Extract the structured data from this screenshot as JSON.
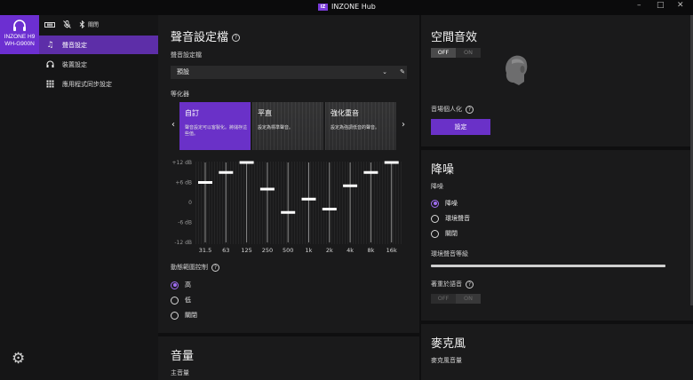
{
  "window": {
    "title": "INZONE Hub",
    "logo_text": "IZ",
    "controls": {
      "minimize": "–",
      "maximize": "□",
      "close": "✕"
    }
  },
  "sidebar": {
    "device": {
      "name": "INZONE H9",
      "model": "WH-G900N"
    },
    "status": {
      "battery": "▮▮▮",
      "anc_label": "關閉"
    },
    "items": [
      {
        "label": "聲音設定",
        "icon": "♫",
        "active": true
      },
      {
        "label": "裝置設定",
        "icon": "headphones",
        "active": false
      },
      {
        "label": "應用程式同步設定",
        "icon": "grid",
        "active": false
      }
    ],
    "settings_icon": "⚙"
  },
  "sound": {
    "title": "聲音設定檔",
    "profile_label": "聲音設定檔",
    "profile_value": "預設",
    "eq_label": "等化器",
    "presets": [
      {
        "name": "自訂",
        "desc": "聲音設定可以客製化。將儲存這些值。",
        "active": true
      },
      {
        "name": "平直",
        "desc": "設定為標準聲音。",
        "active": false
      },
      {
        "name": "強化重音",
        "desc": "設定為強調低音的聲音。",
        "active": false
      }
    ],
    "eq_y_ticks": [
      "+12 dB",
      "+6 dB",
      "0",
      "-6 dB",
      "-12 dB"
    ],
    "dynamic_range_label": "動態範圍控制",
    "dynamic_range_options": [
      {
        "label": "高",
        "selected": true
      },
      {
        "label": "低",
        "selected": false
      },
      {
        "label": "關閉",
        "selected": false
      }
    ]
  },
  "chart_data": {
    "type": "bar",
    "categories": [
      "31.5",
      "63",
      "125",
      "250",
      "500",
      "1k",
      "2k",
      "4k",
      "8k",
      "16k"
    ],
    "values": [
      6,
      9,
      12,
      4,
      -3,
      1,
      -2,
      5,
      9,
      12
    ],
    "ylim": [
      -12,
      12
    ],
    "yticks": [
      "+12 dB",
      "+6 dB",
      "0",
      "-6 dB",
      "-12 dB"
    ]
  },
  "volume": {
    "title": "音量",
    "master_label": "主音量"
  },
  "spatial": {
    "title": "空間音效",
    "toggle": {
      "off": "OFF",
      "on": "ON",
      "state": "off"
    },
    "personalize_label": "音場個人化",
    "set_button": "設定"
  },
  "noise": {
    "title": "降噪",
    "section_label": "降噪",
    "options": [
      {
        "label": "降噪",
        "selected": true
      },
      {
        "label": "環境聲音",
        "selected": false
      },
      {
        "label": "關閉",
        "selected": false
      }
    ],
    "ambient_level_label": "環境聲音等級",
    "focus_voice_label": "著重於語音",
    "focus_toggle": {
      "off": "OFF",
      "on": "ON",
      "state": "off"
    }
  },
  "mic": {
    "title": "麥克風",
    "volume_label": "麥克風音量"
  }
}
